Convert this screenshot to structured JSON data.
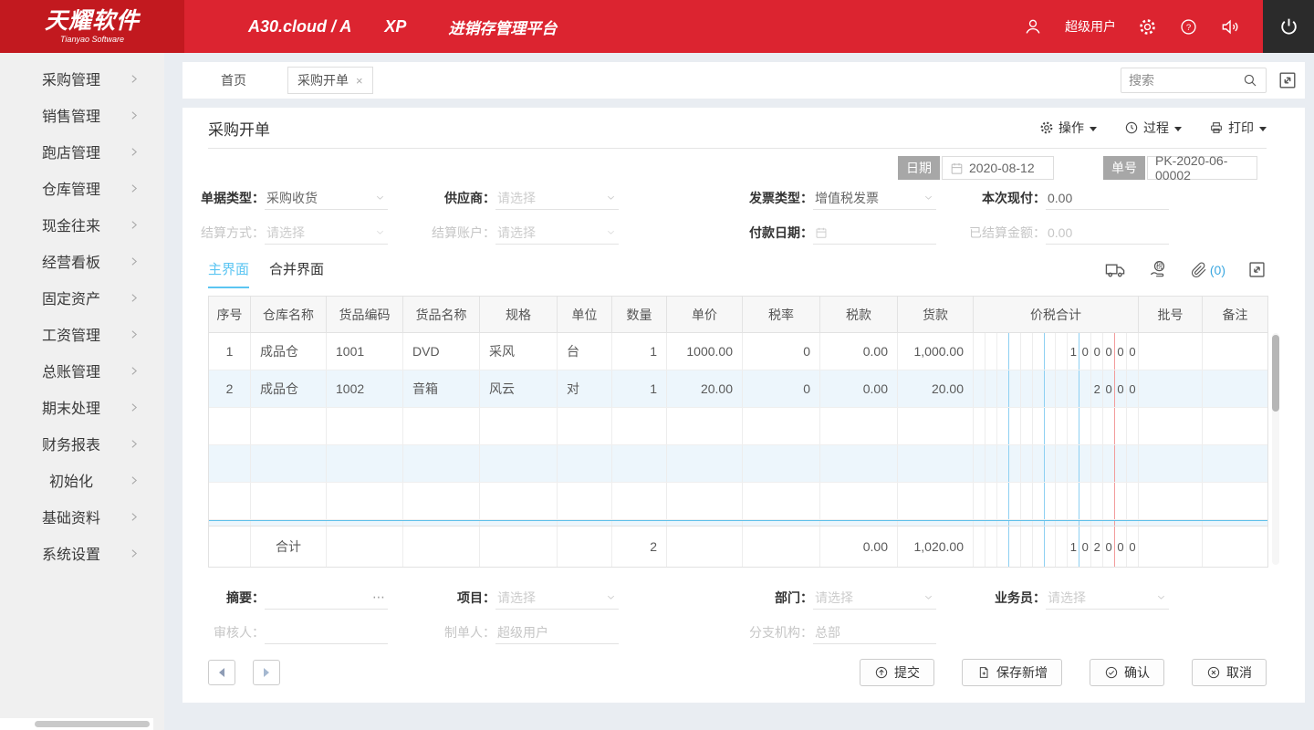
{
  "colors": {
    "brand_red": "#dc2430",
    "logo_red": "#c2191f",
    "accent_blue": "#5bc5f2",
    "count_blue": "#3aa7e0",
    "power_block_dark": "#2b2b2b",
    "alt_row_blue": "#edf6fc",
    "amount_grid_blue_line": "#8ed0f2",
    "amount_grid_red_line": "#f29c9c"
  },
  "topbar": {
    "logo_title": "天耀软件",
    "logo_subtitle": "Tianyao Software",
    "product": "A30.cloud / A",
    "edition": "XP",
    "platform": "进销存管理平台",
    "username": "超级用户"
  },
  "sidebar": {
    "items": [
      "采购管理",
      "销售管理",
      "跑店管理",
      "仓库管理",
      "现金往来",
      "经营看板",
      "固定资产",
      "工资管理",
      "总账管理",
      "期末处理",
      "财务报表",
      "初始化",
      "基础资料",
      "系统设置"
    ]
  },
  "tabbar": {
    "home": "首页",
    "active_tab": "采购开单",
    "search_placeholder": "搜索"
  },
  "page": {
    "title": "采购开单",
    "toolbar": {
      "operate": "操作",
      "process": "过程",
      "print": "打印"
    },
    "date_label": "日期",
    "date_value": "2020-08-12",
    "order_label": "单号",
    "order_value": "PK-2020-06-00002",
    "view_tabs": {
      "main": "主界面",
      "merged": "合并界面"
    },
    "attachment_count": "(0)"
  },
  "form": {
    "doc_type": {
      "label": "单据类型：",
      "value": "采购收货"
    },
    "supplier": {
      "label": "供应商：",
      "placeholder": "请选择"
    },
    "invoice_type": {
      "label": "发票类型：",
      "value": "增值税发票"
    },
    "cash_paid": {
      "label": "本次现付：",
      "value": "0.00"
    },
    "settle_method": {
      "label": "结算方式：",
      "placeholder": "请选择"
    },
    "settle_account": {
      "label": "结算账户：",
      "placeholder": "请选择"
    },
    "pay_date": {
      "label": "付款日期："
    },
    "settled_amount": {
      "label": "已结算金额：",
      "value": "0.00"
    }
  },
  "table": {
    "columns": [
      "序号",
      "仓库名称",
      "货品编码",
      "货品名称",
      "规格",
      "单位",
      "数量",
      "单价",
      "税率",
      "税款",
      "货款",
      "价税合计",
      "批号",
      "备注"
    ],
    "rows": [
      {
        "cells": [
          "1",
          "成品仓",
          "1001",
          "DVD",
          "采风",
          "台",
          "1",
          "1000.00",
          "0",
          "0.00",
          "1,000.00"
        ],
        "amount": {
          "int": "1000",
          "dec": "00"
        }
      },
      {
        "cells": [
          "2",
          "成品仓",
          "1002",
          "音箱",
          "风云",
          "对",
          "1",
          "20.00",
          "0",
          "0.00",
          "20.00"
        ],
        "amount": {
          "int": "20",
          "dec": "00"
        }
      }
    ],
    "empty_row_count": 3,
    "total_row": {
      "cells": [
        "",
        "合计",
        "",
        "",
        "",
        "",
        "2",
        "",
        "",
        "0.00",
        "1,020.00"
      ],
      "amount": {
        "int": "1020",
        "dec": "00"
      }
    }
  },
  "footer_form": {
    "summary": {
      "label": "摘要："
    },
    "project": {
      "label": "项目：",
      "placeholder": "请选择"
    },
    "department": {
      "label": "部门：",
      "placeholder": "请选择"
    },
    "salesman": {
      "label": "业务员：",
      "placeholder": "请选择"
    },
    "auditor": {
      "label": "审核人："
    },
    "creator": {
      "label": "制单人：",
      "value": "超级用户"
    },
    "branch": {
      "label": "分支机构：",
      "value": "总部"
    }
  },
  "actions": {
    "submit": "提交",
    "save_new": "保存新增",
    "confirm": "确认",
    "cancel": "取消"
  }
}
